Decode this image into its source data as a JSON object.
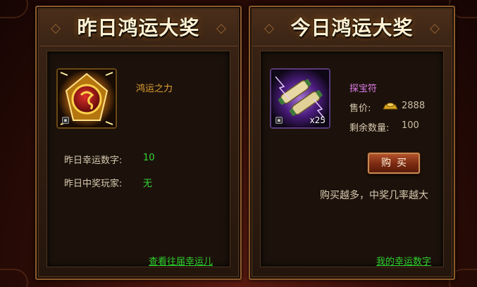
{
  "yesterday": {
    "title": "昨日鸿运大奖",
    "item_name": "鸿运之力",
    "lucky_number_label": "昨日幸运数字:",
    "lucky_number_value": "10",
    "winner_label": "昨日中奖玩家:",
    "winner_value": "无",
    "history_link": "查看往届幸运儿",
    "item_icon": "golden-seal-icon"
  },
  "today": {
    "title": "今日鸿运大奖",
    "item_name": "探宝符",
    "item_quantity": "x25",
    "item_icon": "scroll-icon",
    "price_label": "售价:",
    "price_value": "2888",
    "currency_icon": "gold-ingot-icon",
    "remaining_label": "剩余数量:",
    "remaining_value": "100",
    "buy_button": "购买",
    "hint": "购买越多，中奖几率越大",
    "my_numbers_link": "我的幸运数字"
  },
  "colors": {
    "accent_green": "#33d633",
    "item_name_orange": "#e3a235",
    "item_name_purple": "#e07be9",
    "panel_border": "#8b5a2b"
  }
}
